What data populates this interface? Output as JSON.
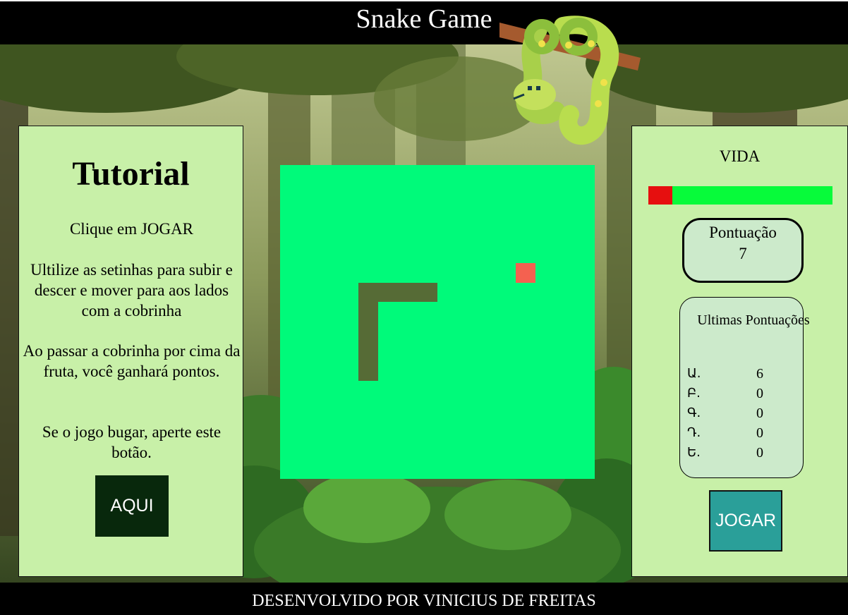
{
  "header": {
    "title": "Snake Game"
  },
  "tutorial": {
    "title": "Tutorial",
    "p1": "Clique em JOGAR",
    "p2": "Ultilize as setinhas para subir e descer e mover para aos lados com a cobrinha",
    "p3": "Ao passar a cobrinha por cima da fruta, você ganhará pontos.",
    "p4": "Se o jogo bugar, aperte este botão.",
    "button": "AQUI"
  },
  "status": {
    "life_label": "VIDA",
    "life_remaining_fraction": 0.87,
    "score_label": "Pontuação",
    "score": "7",
    "history_title": "Ultimas Pontuações",
    "history": [
      {
        "label": "Ա.",
        "value": "6"
      },
      {
        "label": "Բ.",
        "value": "0"
      },
      {
        "label": "Գ.",
        "value": "0"
      },
      {
        "label": "Դ.",
        "value": "0"
      },
      {
        "label": "Ե.",
        "value": "0"
      }
    ],
    "play_button": "JOGAR"
  },
  "colors": {
    "board": "#00fa7a",
    "snake": "#566b36",
    "fruit": "#f46150",
    "panel": "#c8f0a8",
    "life_ok": "#07fb3a",
    "life_lost": "#e60f0f"
  },
  "footer": {
    "credit": "DESENVOLVIDO POR VINICIUS DE FREITAS"
  }
}
